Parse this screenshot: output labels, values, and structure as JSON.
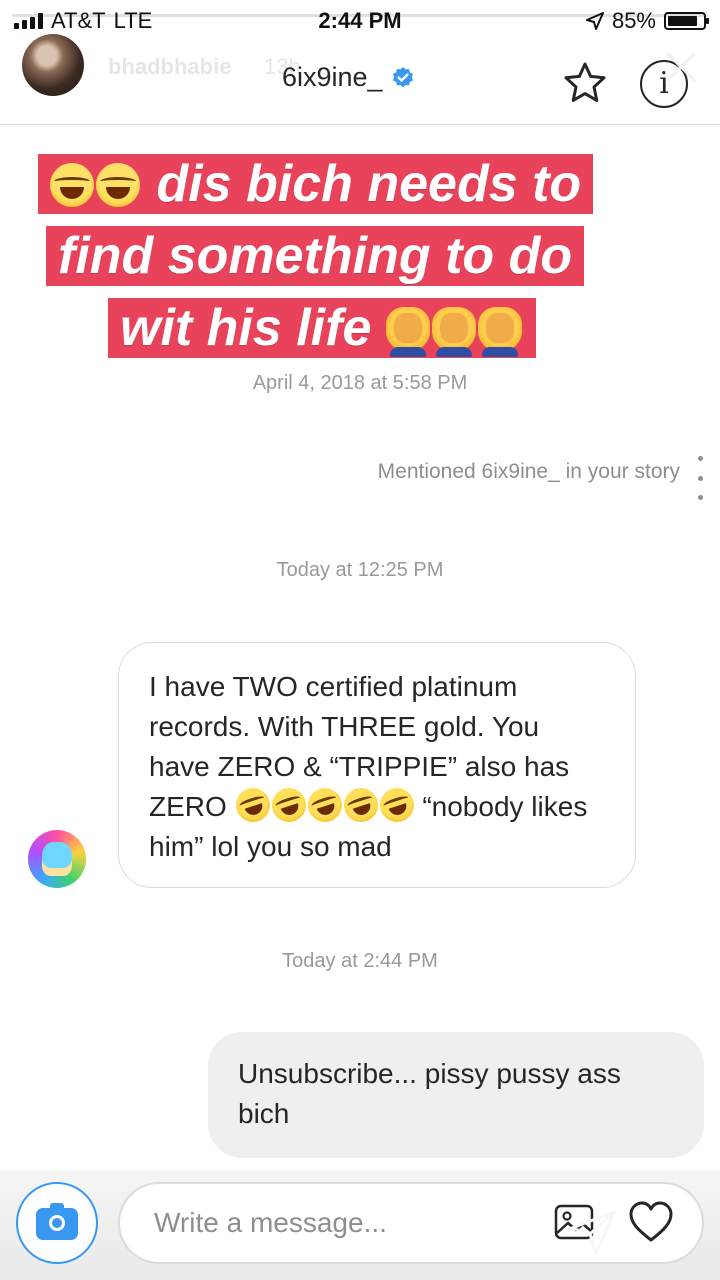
{
  "status_bar": {
    "carrier": "AT&T",
    "network": "LTE",
    "time": "2:44 PM",
    "battery": "85%",
    "battery_level": 0.85
  },
  "story_overlay": {
    "username": "bhadbhabie",
    "age": "13h"
  },
  "thread": {
    "title": "6ix9ine_",
    "verified": true
  },
  "icons": {
    "star": "star-icon",
    "info": "info-icon",
    "close": "close-icon",
    "camera": "camera-icon",
    "gallery": "gallery-icon",
    "heart": "heart-icon",
    "send": "send-icon",
    "more": "more-vertical-icon"
  },
  "caption": {
    "line1": "dis bich needs to",
    "line2": "find something to do",
    "line3": "wit his life"
  },
  "messages": {
    "ts1": "April 4, 2018 at 5:58 PM",
    "mention": "Mentioned 6ix9ine_ in your story",
    "ts2": "Today at 12:25 PM",
    "in_part1": "I have TWO certified platinum records. With THREE gold. You have ZERO & “TRIPPIE” also has ZERO ",
    "in_part2": " “nobody likes him” lol you so mad",
    "ts3": "Today at 2:44 PM",
    "out_text": "Unsubscribe... pissy pussy ass bich"
  },
  "composer": {
    "placeholder": "Write a message..."
  },
  "colors": {
    "caption_bg": "#e8435a",
    "accent": "#3897f0",
    "verified": "#3897f0"
  }
}
